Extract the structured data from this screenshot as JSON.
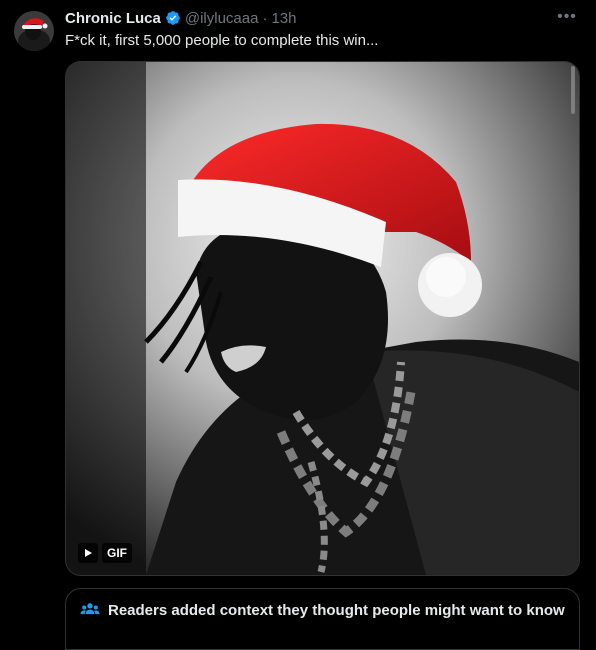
{
  "tweet": {
    "author": {
      "display_name": "Chronic Luca",
      "handle": "@ilylucaaa",
      "verified": true,
      "separator": "·",
      "timestamp": "13h"
    },
    "text": "F*ck it, first 5,000 people to complete this win...",
    "more_icon": "more-horizontal-icon",
    "media": {
      "type": "gif",
      "badge_label": "GIF",
      "play_icon": "play-icon"
    },
    "community_note": {
      "icon": "people-icon",
      "label": "Readers added context they thought people might want to know"
    }
  },
  "colors": {
    "background": "#000000",
    "text": "#e7e9ea",
    "muted": "#71767b",
    "verified": "#1d9bf0",
    "border": "#2f3336",
    "hat_red": "#d8161b"
  }
}
